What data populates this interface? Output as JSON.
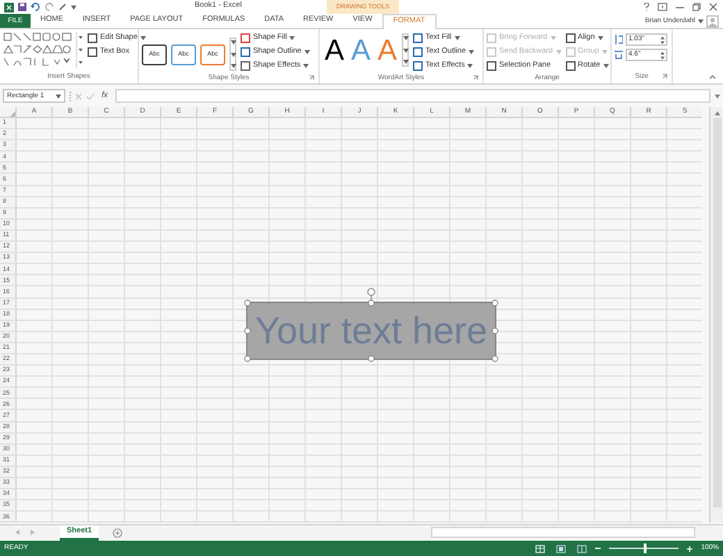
{
  "window": {
    "title": "Book1 - Excel",
    "context_tab": "DRAWING TOOLS",
    "user": "Brian Underdahl"
  },
  "ribbon_tabs": [
    {
      "label": "FILE",
      "kind": "file",
      "selected": false
    },
    {
      "label": "HOME",
      "kind": "tab",
      "selected": false
    },
    {
      "label": "INSERT",
      "kind": "tab",
      "selected": false
    },
    {
      "label": "PAGE LAYOUT",
      "kind": "tab",
      "selected": false
    },
    {
      "label": "FORMULAS",
      "kind": "tab",
      "selected": false
    },
    {
      "label": "DATA",
      "kind": "tab",
      "selected": false
    },
    {
      "label": "REVIEW",
      "kind": "tab",
      "selected": false
    },
    {
      "label": "VIEW",
      "kind": "tab",
      "selected": false
    },
    {
      "label": "FORMAT",
      "kind": "context",
      "selected": true
    }
  ],
  "insert_shapes": {
    "label": "Insert Shapes",
    "commands": [
      {
        "label": "Edit Shape",
        "dropdown": true
      },
      {
        "label": "Text Box",
        "dropdown": false
      }
    ]
  },
  "shape_styles": {
    "label": "Shape Styles",
    "presets": [
      {
        "text": "Abc",
        "color": "#404040"
      },
      {
        "text": "Abc",
        "color": "#5b9bd5"
      },
      {
        "text": "Abc",
        "color": "#ed7d31"
      }
    ],
    "commands": [
      {
        "label": "Shape Fill",
        "dropdown": true
      },
      {
        "label": "Shape Outline",
        "dropdown": true
      },
      {
        "label": "Shape Effects",
        "dropdown": true
      }
    ]
  },
  "wordart_styles": {
    "label": "WordArt Styles",
    "presets": [
      {
        "text": "A",
        "color": "#000000"
      },
      {
        "text": "A",
        "color": "#5b9bd5"
      },
      {
        "text": "A",
        "color": "#ed7d31"
      }
    ],
    "commands": [
      {
        "label": "Text Fill",
        "dropdown": true
      },
      {
        "label": "Text Outline",
        "dropdown": true
      },
      {
        "label": "Text Effects",
        "dropdown": true
      }
    ]
  },
  "arrange": {
    "label": "Arrange",
    "commands": [
      {
        "label": "Bring Forward",
        "dropdown": true,
        "disabled": true
      },
      {
        "label": "Send Backward",
        "dropdown": true,
        "disabled": true
      },
      {
        "label": "Selection Pane",
        "dropdown": false,
        "disabled": false
      }
    ],
    "commands_2": [
      {
        "label": "Align",
        "dropdown": true,
        "disabled": false
      },
      {
        "label": "Group",
        "dropdown": true,
        "disabled": true
      },
      {
        "label": "Rotate",
        "dropdown": true,
        "disabled": false
      }
    ]
  },
  "size": {
    "label": "Size",
    "height": "1.03\"",
    "width": "4.6\""
  },
  "formula_bar": {
    "name_box": "Rectangle 1",
    "function_label": "fx"
  },
  "sheet": {
    "columns": [
      "A",
      "B",
      "C",
      "D",
      "E",
      "F",
      "G",
      "H",
      "I",
      "J",
      "K",
      "L",
      "M",
      "N",
      "O",
      "P",
      "Q",
      "R",
      "S"
    ],
    "rows": [
      "1",
      "2",
      "3",
      "4",
      "5",
      "6",
      "7",
      "8",
      "9",
      "10",
      "11",
      "12",
      "13",
      "14",
      "15",
      "16",
      "17",
      "18",
      "19",
      "20",
      "21",
      "22",
      "23",
      "24",
      "25",
      "26",
      "27",
      "28",
      "29",
      "30",
      "31",
      "32",
      "33",
      "34",
      "35",
      "36"
    ]
  },
  "shape": {
    "text": "Your text here",
    "selected": true
  },
  "sheet_tabs": [
    {
      "label": "Sheet1",
      "selected": true
    }
  ],
  "status_bar": {
    "mode": "READY",
    "zoom": "100%",
    "zoom_slider": {
      "level": 0.5
    }
  }
}
